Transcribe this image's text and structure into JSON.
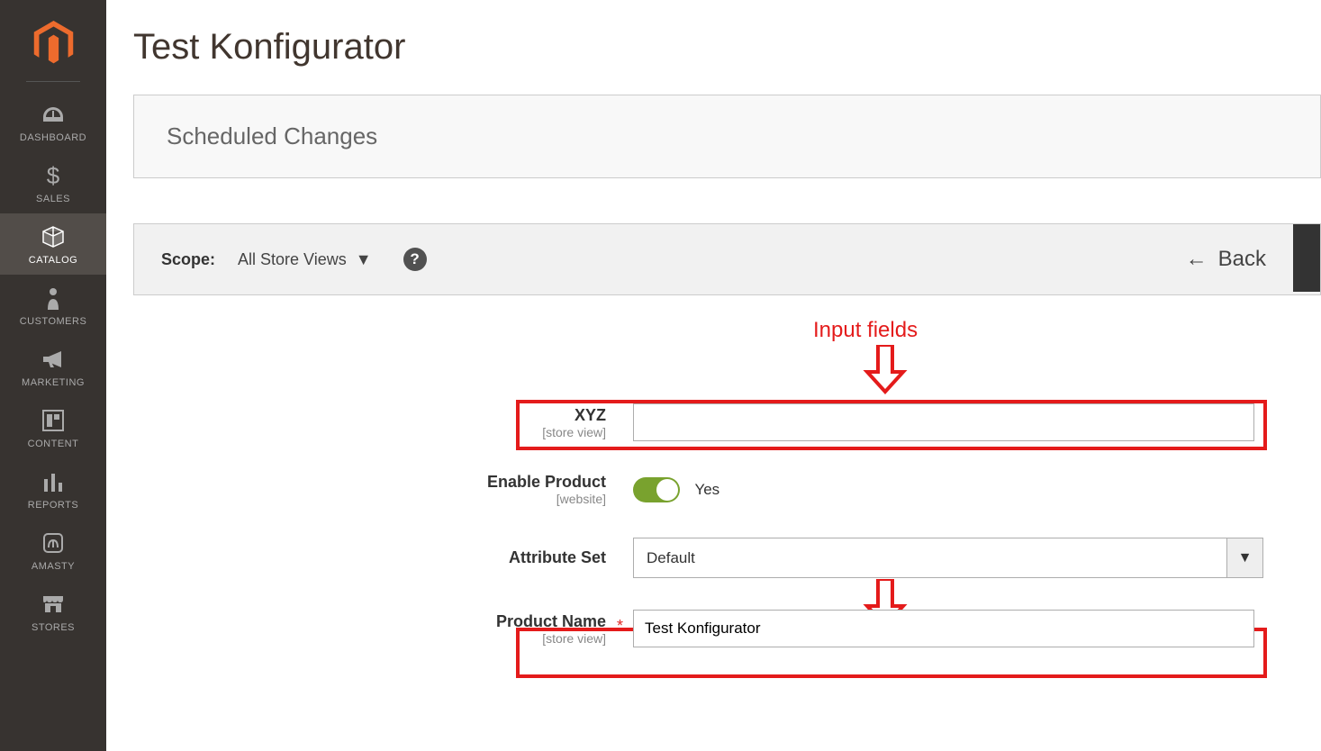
{
  "sidebar": {
    "items": [
      {
        "label": "DASHBOARD"
      },
      {
        "label": "SALES"
      },
      {
        "label": "CATALOG"
      },
      {
        "label": "CUSTOMERS"
      },
      {
        "label": "MARKETING"
      },
      {
        "label": "CONTENT"
      },
      {
        "label": "REPORTS"
      },
      {
        "label": "AMASTY"
      },
      {
        "label": "STORES"
      }
    ]
  },
  "page": {
    "title": "Test Konfigurator",
    "scheduled_changes": "Scheduled Changes"
  },
  "toolbar": {
    "scope_label": "Scope:",
    "scope_value": "All Store Views",
    "help": "?",
    "back": "Back"
  },
  "form": {
    "xyz": {
      "label": "XYZ",
      "scope": "[store view]",
      "value": ""
    },
    "enable": {
      "label": "Enable Product",
      "scope": "[website]",
      "value": "Yes"
    },
    "attribute_set": {
      "label": "Attribute Set",
      "value": "Default"
    },
    "product_name": {
      "label": "Product Name",
      "scope": "[store view]",
      "value": "Test Konfigurator"
    }
  },
  "annotation": {
    "label": "Input fields"
  }
}
